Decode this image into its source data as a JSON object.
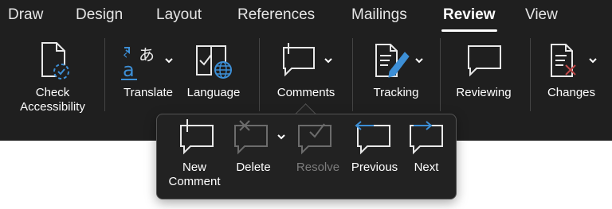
{
  "tabs": [
    {
      "label": "Draw",
      "active": false
    },
    {
      "label": "Design",
      "active": false
    },
    {
      "label": "Layout",
      "active": false
    },
    {
      "label": "References",
      "active": false
    },
    {
      "label": "Mailings",
      "active": false
    },
    {
      "label": "Review",
      "active": true
    },
    {
      "label": "View",
      "active": false
    }
  ],
  "ribbon": {
    "check_accessibility": {
      "line1": "Check",
      "line2": "Accessibility",
      "icon": "check-accessibility-icon"
    },
    "translate": {
      "label": "Translate",
      "icon": "translate-icon"
    },
    "language": {
      "label": "Language",
      "icon": "language-icon"
    },
    "comments": {
      "label": "Comments",
      "icon": "comment-icon"
    },
    "tracking": {
      "label": "Tracking",
      "icon": "tracking-icon"
    },
    "reviewing": {
      "label": "Reviewing",
      "icon": "reviewing-icon"
    },
    "changes": {
      "label": "Changes",
      "icon": "changes-icon"
    }
  },
  "comments_menu": {
    "new_comment": {
      "line1": "New",
      "line2": "Comment",
      "icon": "new-comment-icon"
    },
    "delete": {
      "label": "Delete",
      "icon": "delete-comment-icon"
    },
    "resolve": {
      "label": "Resolve",
      "icon": "resolve-comment-icon",
      "disabled": true
    },
    "previous": {
      "label": "Previous",
      "icon": "previous-comment-icon"
    },
    "next": {
      "label": "Next",
      "icon": "next-comment-icon"
    }
  },
  "colors": {
    "ribbon_bg": "#1f1f1f",
    "text": "#ffffff",
    "accent_blue": "#3d8fd6",
    "disabled": "#7c7c7c",
    "document_bg": "#ffffff"
  }
}
